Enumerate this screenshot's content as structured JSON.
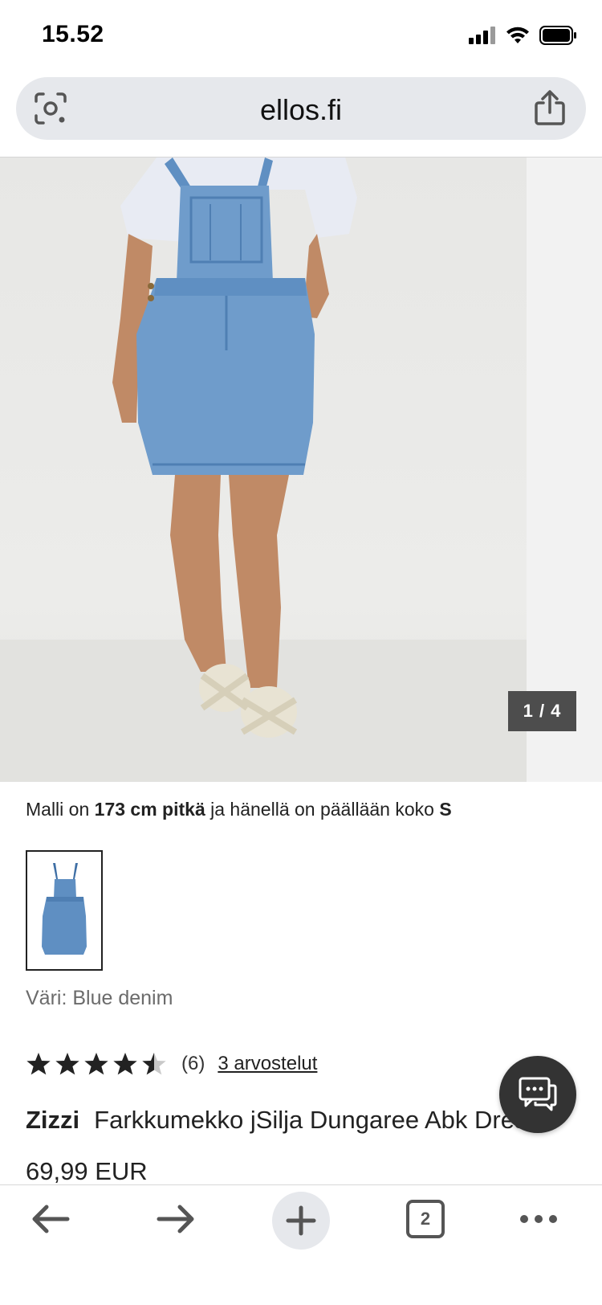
{
  "status_bar": {
    "time": "15.52",
    "icons": [
      "signal-icon",
      "wifi-icon",
      "battery-icon"
    ]
  },
  "browser": {
    "url": "ellos.fi",
    "lens_icon": "visual-search-icon",
    "share_icon": "share-icon"
  },
  "gallery": {
    "counter": "1 / 4",
    "caption": {
      "prefix": "Malli on ",
      "height": "173 cm pitkä",
      "middle": " ja hänellä on päällään koko ",
      "size": "S"
    }
  },
  "product": {
    "color_label": "Väri: Blue denim",
    "rating": {
      "value": 4.5,
      "max": 5,
      "count": "(6)",
      "reviews_link": "3 arvostelut"
    },
    "brand": "Zizzi",
    "title": "Farkkumekko jSilja Dungaree Abk Dress",
    "price": "69,99 EUR"
  },
  "toolbar": {
    "items": [
      "back-icon",
      "forward-icon",
      "new-tab-icon",
      "tabs-icon",
      "more-icon"
    ],
    "tab_count": "2"
  },
  "colors": {
    "denim": "#6f9ccb",
    "accent_dark": "#333333",
    "url_bar_bg": "#e6e8ec"
  }
}
